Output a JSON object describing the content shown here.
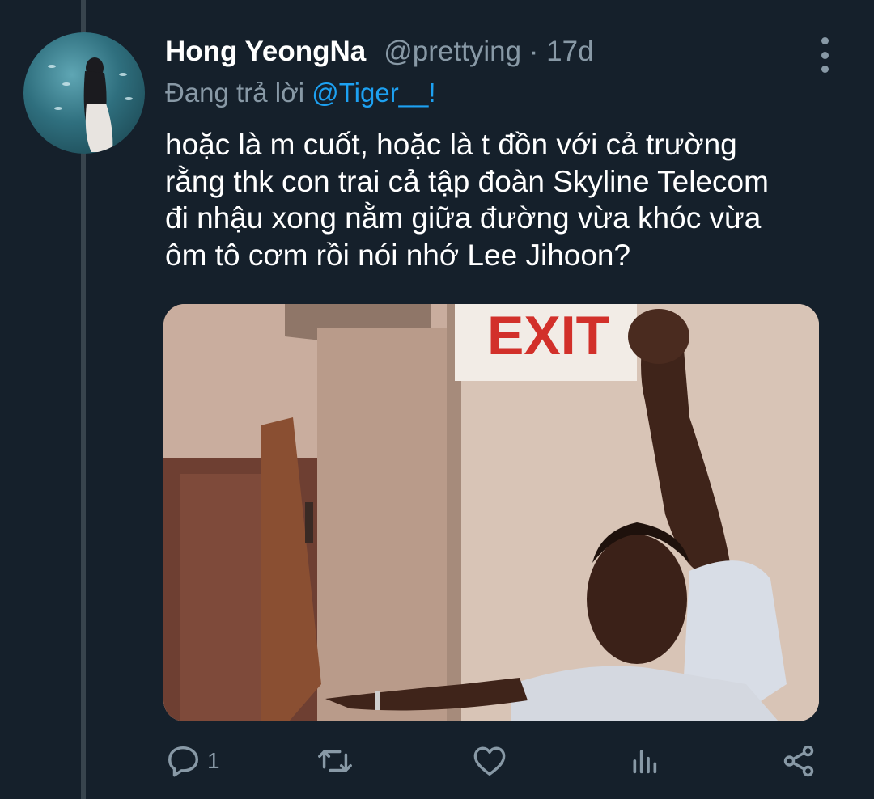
{
  "tweet": {
    "author_name": "Hong YeongNa",
    "handle": "@prettying",
    "separator": "·",
    "time": "17d",
    "reply_prefix": "Đang trả lời",
    "reply_to": "@Tiger__!",
    "text_lines": [
      "hoặc là m cuốt, hoặc là t đồn với cả trường",
      "rằng thk con trai cả tập đoàn Skyline Telecom",
      "đi nhậu xong nằm giữa đường vừa khóc vừa",
      "ôm tô cơm rồi nói nhớ Lee Jihoon?"
    ],
    "media": {
      "sign_text": "EXIT",
      "sign_color": "#d2302a"
    }
  },
  "actions": {
    "reply": {
      "icon": "reply-icon",
      "count": "1"
    },
    "retweet": {
      "icon": "retweet-icon"
    },
    "like": {
      "icon": "heart-icon"
    },
    "analytics": {
      "icon": "analytics-icon"
    },
    "share": {
      "icon": "share-icon"
    }
  },
  "colors": {
    "background": "#15202b",
    "secondary_text": "#8899a6",
    "accent": "#1da1f2",
    "thread_line": "#38444d"
  }
}
